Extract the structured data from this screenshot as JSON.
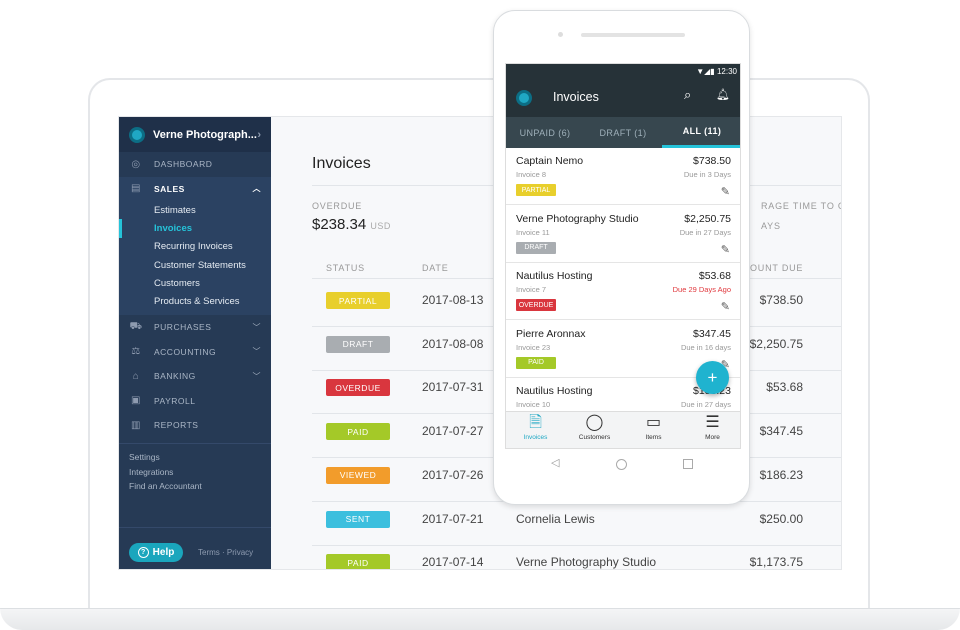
{
  "sidebar": {
    "company": "Verne Photograph...",
    "dashboard": "DASHBOARD",
    "sales": "SALES",
    "sales_items": [
      "Estimates",
      "Invoices",
      "Recurring Invoices",
      "Customer Statements",
      "Customers",
      "Products & Services"
    ],
    "active_item": "Invoices",
    "sections": [
      "PURCHASES",
      "ACCOUNTING",
      "BANKING",
      "PAYROLL",
      "REPORTS"
    ],
    "links": [
      "Settings",
      "Integrations",
      "Find an Accountant"
    ],
    "help": "Help",
    "terms": "Terms",
    "privacy": "Privacy",
    "sep": "·"
  },
  "main": {
    "title": "Invoices",
    "overdue_label": "OVERDUE",
    "overdue_amount": "$238.34",
    "currency": "USD",
    "avg_label": "RAGE TIME TO GET",
    "avg_value": "AYS",
    "headers": {
      "status": "STATUS",
      "date": "DATE",
      "amount": "OUNT DUE"
    },
    "rows": [
      {
        "status": "PARTIAL",
        "color": "#e8cf2c",
        "date": "2017-08-13",
        "customer": "",
        "amount": "$738.50"
      },
      {
        "status": "DRAFT",
        "color": "#a9adb1",
        "date": "2017-08-08",
        "customer": "",
        "amount": "$2,250.75"
      },
      {
        "status": "OVERDUE",
        "color": "#d9363e",
        "date": "2017-07-31",
        "customer": "",
        "amount": "$53.68"
      },
      {
        "status": "PAID",
        "color": "#a4c928",
        "date": "2017-07-27",
        "customer": "",
        "amount": "$347.45"
      },
      {
        "status": "VIEWED",
        "color": "#f29c2b",
        "date": "2017-07-26",
        "customer": "",
        "amount": "$186.23"
      },
      {
        "status": "SENT",
        "color": "#3cbfde",
        "date": "2017-07-21",
        "customer": "Cornelia Lewis",
        "amount": "$250.00"
      },
      {
        "status": "PAID",
        "color": "#a4c928",
        "date": "2017-07-14",
        "customer": "Verne Photography Studio",
        "amount": "$1,173.75"
      }
    ]
  },
  "phone": {
    "time": "12:30",
    "title": "Invoices",
    "tabs": [
      "UNPAID (6)",
      "DRAFT (1)",
      "ALL (11)"
    ],
    "active_tab": "ALL (11)",
    "items": [
      {
        "name": "Captain Nemo",
        "invoice": "Invoice 8",
        "amount": "$738.50",
        "due": "Due in 3 Days",
        "status": "PARTIAL",
        "color": "#e8cf2c",
        "overdue": false
      },
      {
        "name": "Verne Photography Studio",
        "invoice": "Invoice 11",
        "amount": "$2,250.75",
        "due": "Due in 27 Days",
        "status": "DRAFT",
        "color": "#a9adb1",
        "overdue": false
      },
      {
        "name": "Nautilus Hosting",
        "invoice": "Invoice 7",
        "amount": "$53.68",
        "due": "Due 29 Days Ago",
        "status": "OVERDUE",
        "color": "#d9363e",
        "overdue": true
      },
      {
        "name": "Pierre Aronnax",
        "invoice": "Invoice 23",
        "amount": "$347.45",
        "due": "Due in 16 days",
        "status": "PAID",
        "color": "#a4c928",
        "overdue": false
      },
      {
        "name": "Nautilus Hosting",
        "invoice": "Invoice 10",
        "amount": "$186.23",
        "due": "Due in 27 days",
        "status": "",
        "color": "",
        "overdue": false
      }
    ],
    "fab": "+",
    "nav": [
      "Invoices",
      "Customers",
      "Items",
      "More"
    ]
  },
  "colors": {
    "sidebar": "#263a55",
    "accent": "#25c3d9",
    "appbar": "#263238",
    "tabs": "#37474f"
  }
}
